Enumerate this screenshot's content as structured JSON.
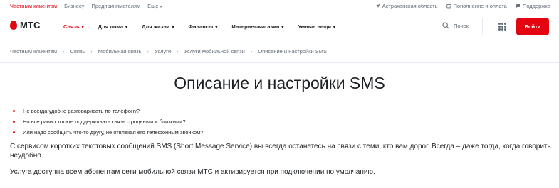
{
  "topbar": {
    "segments": [
      {
        "label": "Частным клиентам",
        "active": true
      },
      {
        "label": "Бизнесу",
        "active": false
      },
      {
        "label": "Предпринимателям",
        "active": false
      },
      {
        "label": "Еще",
        "active": false
      }
    ],
    "more_caret": "▾",
    "region": "Астраханская область",
    "payment": "Пополнение и оплата",
    "support": "Поддержка"
  },
  "nav": {
    "logo": "МТС",
    "items": [
      {
        "label": "Связь",
        "active": true
      },
      {
        "label": "Для дома",
        "active": false
      },
      {
        "label": "Для жизни",
        "active": false
      },
      {
        "label": "Финансы",
        "active": false
      },
      {
        "label": "Интернет-магазин",
        "active": false
      },
      {
        "label": "Умные вещи",
        "active": false
      }
    ],
    "caret": "▾",
    "search_label": "Поиск",
    "login_label": "Войти"
  },
  "breadcrumb": [
    "Частным клиентам",
    "Связь",
    "Мобильная связь",
    "Услуги",
    "Услуги мобильной связи",
    "Описание и настройки SMS"
  ],
  "breadcrumb_separator": "›",
  "content": {
    "title": "Описание и настройки SMS",
    "bullets": [
      "Не всегда удобно разговаривать по телефону?",
      "Но все равно хотите поддерживать связь с родными и близкими?",
      "Или надо сообщить что-то другу, не отвлекая его телефонным звонком?"
    ],
    "paragraph1": "С сервисом коротких текстовых сообщений SMS (Short Message Service) вы всегда останетесь на связи с теми, кто вам дорог. Всегда – даже тогда, когда говорить неудобно.",
    "paragraph2": "Услуга доступна всем абонентам сети мобильной связи МТС и активируется при подключении по умолчанию."
  },
  "colors": {
    "brand_red": "#e30611",
    "text": "#1d2023",
    "muted": "#626c77"
  },
  "icons": [
    "location-icon",
    "wallet-icon",
    "support-icon",
    "search-icon",
    "apps-grid-icon",
    "mts-egg-logo-icon"
  ]
}
